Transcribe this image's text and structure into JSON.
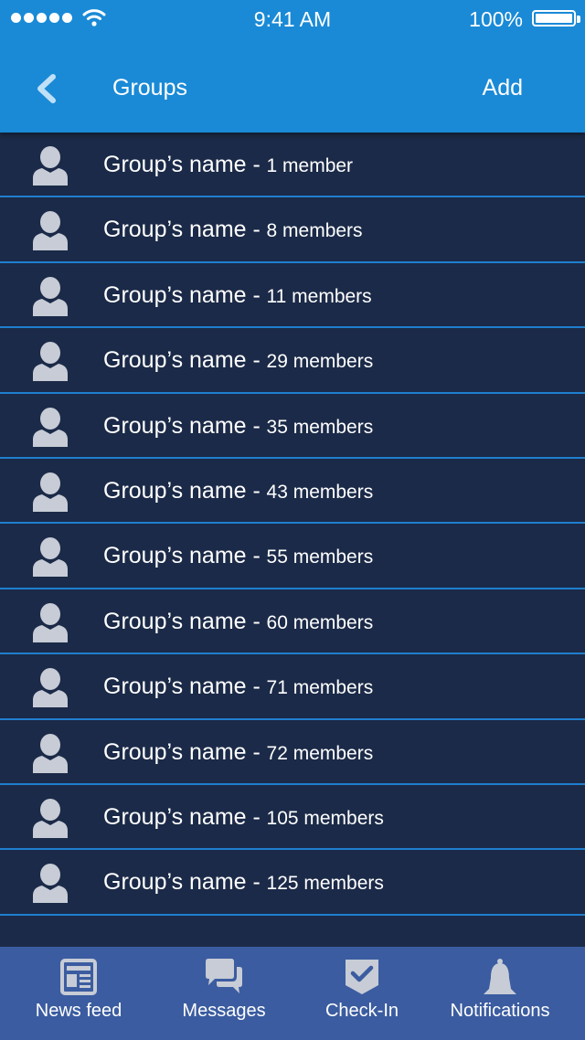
{
  "status_bar": {
    "time": "9:41 AM",
    "battery": "100%"
  },
  "nav": {
    "title": "Groups",
    "add_label": "Add"
  },
  "groups": [
    {
      "name": "Group’s name -",
      "count": "1 member"
    },
    {
      "name": "Group’s name -",
      "count": "8 members"
    },
    {
      "name": "Group’s name -",
      "count": "11 members"
    },
    {
      "name": "Group’s name -",
      "count": "29 members"
    },
    {
      "name": "Group’s name -",
      "count": "35 members"
    },
    {
      "name": "Group’s name -",
      "count": "43 members"
    },
    {
      "name": "Group’s name -",
      "count": "55 members"
    },
    {
      "name": "Group’s name -",
      "count": "60 members"
    },
    {
      "name": "Group’s name -",
      "count": "71 members"
    },
    {
      "name": "Group’s name -",
      "count": "72 members"
    },
    {
      "name": "Group’s name -",
      "count": "105 members"
    },
    {
      "name": "Group’s name -",
      "count": "125 members"
    }
  ],
  "tabs": [
    {
      "label": "News feed",
      "icon": "newspaper-icon"
    },
    {
      "label": "Messages",
      "icon": "chat-bubbles-icon"
    },
    {
      "label": "Check-In",
      "icon": "checkin-badge-icon"
    },
    {
      "label": "Notifications",
      "icon": "bell-icon"
    }
  ],
  "colors": {
    "header": "#1a8ad6",
    "background": "#1b2a48",
    "separator": "#1f7fcf",
    "tabbar": "#3b5ca0",
    "icon": "#c7ccd6"
  }
}
